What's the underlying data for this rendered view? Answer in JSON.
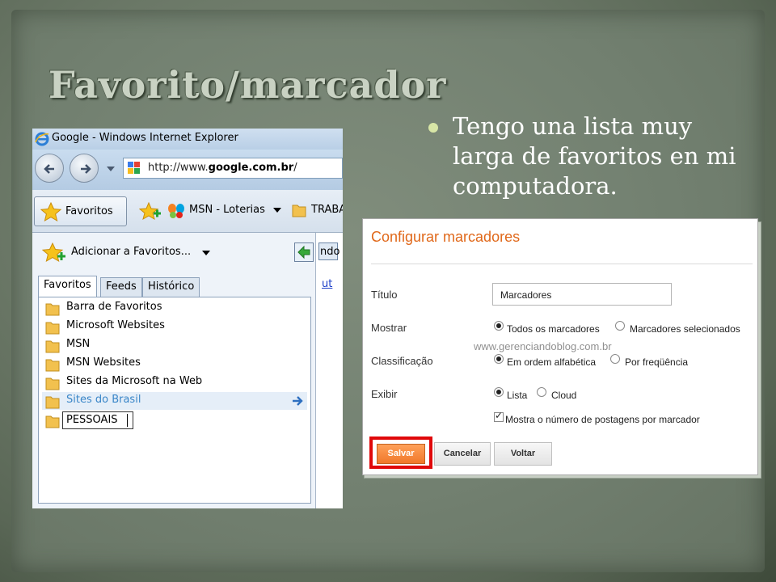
{
  "slide": {
    "title": "Favorito/marcador",
    "bullet": "Tengo una lista muy larga de favoritos en mi computadora."
  },
  "ie": {
    "window_title": "Google - Windows Internet Explorer",
    "address_prefix": "http://www.",
    "address_domain": "google.com.br",
    "address_suffix": "/",
    "favorites_button": "Favoritos",
    "msn_link": "MSN - Loterias",
    "folder_link": "TRABA",
    "add_to_favorites": "Adicionar a Favoritos...",
    "tabs": [
      "Favoritos",
      "Feeds",
      "Histórico"
    ],
    "favorites": [
      {
        "label": "Barra de Favoritos",
        "state": "normal"
      },
      {
        "label": "Microsoft Websites",
        "state": "normal"
      },
      {
        "label": "MSN",
        "state": "normal"
      },
      {
        "label": "MSN Websites",
        "state": "normal"
      },
      {
        "label": "Sites da Microsoft na Web",
        "state": "normal"
      },
      {
        "label": "Sites do Brasil",
        "state": "selected"
      }
    ],
    "editing_item": "PESSOAIS",
    "right_fragment_text": "ndo",
    "right_fragment_link": "ut"
  },
  "blogger": {
    "heading": "Configurar marcadores",
    "titulo_label": "Título",
    "titulo_value": "Marcadores",
    "mostrar_label": "Mostrar",
    "mostrar_options": [
      "Todos os marcadores",
      "Marcadores selecionados"
    ],
    "classificacao_label": "Classificação",
    "classificacao_options": [
      "Em ordem alfabética",
      "Por freqüência"
    ],
    "exibir_label": "Exibir",
    "exibir_options": [
      "Lista",
      "Cloud"
    ],
    "show_count_label": "Mostra o número de postagens por marcador",
    "watermark": "www.gerenciandoblog.com.br",
    "buttons": {
      "save": "Salvar",
      "cancel": "Cancelar",
      "back": "Voltar"
    }
  },
  "colors": {
    "accent_orange": "#e0681a",
    "highlight_red": "#e0080a",
    "bullet_color": "#d8e6a6"
  }
}
